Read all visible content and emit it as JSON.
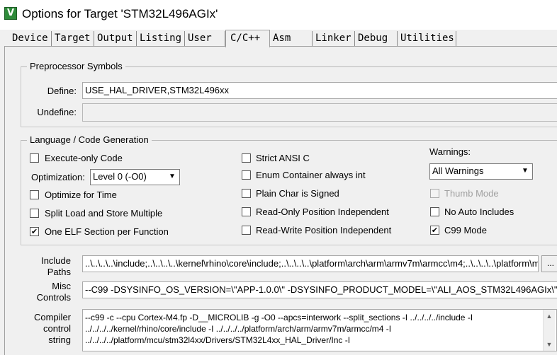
{
  "window": {
    "title": "Options for Target 'STM32L496AGIx'",
    "icon": "keil-uvision-icon",
    "icon_glyph": "V"
  },
  "tabs": [
    {
      "label": "Device"
    },
    {
      "label": "Target"
    },
    {
      "label": "Output"
    },
    {
      "label": "Listing"
    },
    {
      "label": "User"
    },
    {
      "label": "C/C++"
    },
    {
      "label": "Asm"
    },
    {
      "label": "Linker"
    },
    {
      "label": "Debug"
    },
    {
      "label": "Utilities"
    }
  ],
  "active_tab": "C/C++",
  "preprocessor": {
    "title": "Preprocessor Symbols",
    "define_label": "Define:",
    "define_value": "USE_HAL_DRIVER,STM32L496xx",
    "undefine_label": "Undefine:",
    "undefine_value": ""
  },
  "language": {
    "title": "Language / Code Generation",
    "execute_only": {
      "label": "Execute-only Code",
      "checked": false
    },
    "optimization_label": "Optimization:",
    "optimization_value": "Level 0 (-O0)",
    "optimize_time": {
      "label": "Optimize for Time",
      "checked": false
    },
    "split_load_store": {
      "label": "Split Load and Store Multiple",
      "checked": false
    },
    "one_elf_section": {
      "label": "One ELF Section per Function",
      "checked": true,
      "mark": "✔"
    },
    "strict_ansi": {
      "label": "Strict ANSI C",
      "checked": false
    },
    "enum_container": {
      "label": "Enum Container always int",
      "checked": false
    },
    "plain_char": {
      "label": "Plain Char is Signed",
      "checked": false
    },
    "ro_pos_indep": {
      "label": "Read-Only Position Independent",
      "checked": false
    },
    "rw_pos_indep": {
      "label": "Read-Write Position Independent",
      "checked": false
    },
    "warnings_label": "Warnings:",
    "warnings_value": "All Warnings",
    "thumb_mode": {
      "label": "Thumb Mode",
      "checked": false,
      "disabled": true
    },
    "no_auto_includes": {
      "label": "No Auto Includes",
      "checked": false
    },
    "c99_mode": {
      "label": "C99 Mode",
      "checked": true,
      "mark": "✔"
    }
  },
  "include_paths": {
    "label_line1": "Include",
    "label_line2": "Paths",
    "value": "..\\..\\..\\..\\include;..\\..\\..\\..\\kernel\\rhino\\core\\include;..\\..\\..\\..\\platform\\arch\\arm\\armv7m\\armcc\\m4;..\\..\\..\\..\\platform\\m",
    "browse_label": "..."
  },
  "misc_controls": {
    "label_line1": "Misc",
    "label_line2": "Controls",
    "value": "--C99 -DSYSINFO_OS_VERSION=\\\"APP-1.0.0\\\" -DSYSINFO_PRODUCT_MODEL=\\\"ALI_AOS_STM32L496AGIx\\\""
  },
  "compiler_control": {
    "label_line1": "Compiler",
    "label_line2": "control",
    "label_line3": "string",
    "line1": "--c99 -c --cpu Cortex-M4.fp -D__MICROLIB -g -O0 --apcs=interwork --split_sections -I ../../../../include -I",
    "line2": "../../../../kernel/rhino/core/include -I ../../../../platform/arch/arm/armv7m/armcc/m4 -I",
    "line3": "../../../../platform/mcu/stm32l4xx/Drivers/STM32L4xx_HAL_Driver/Inc -I"
  }
}
